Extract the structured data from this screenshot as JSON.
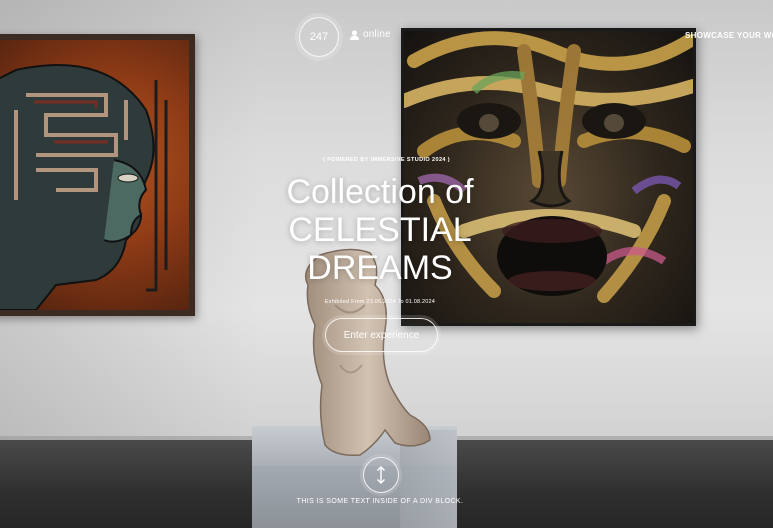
{
  "header": {
    "visitor_count": "247",
    "online_label": "online",
    "showcase_label": "SHOWCASE YOUR WORK"
  },
  "hero": {
    "powered_by": "( POWERED BY IMMERSIVE STUDIO 2024 )",
    "title_line1": "Collection of",
    "title_line2": "CELESTIAL",
    "title_line3": "DREAMS",
    "exhibited": "Exhibited From 23.06.2024 To 01.08.2024",
    "enter_button": "Enter experience"
  },
  "footer": {
    "scroll_icon": "vertical-arrows-icon",
    "text": "THIS IS SOME TEXT INSIDE OF A DIV BLOCK."
  },
  "colors": {
    "overlay_text": "#ffffff",
    "wall": "#dcdcdc",
    "floor": "#2f2f2f"
  }
}
